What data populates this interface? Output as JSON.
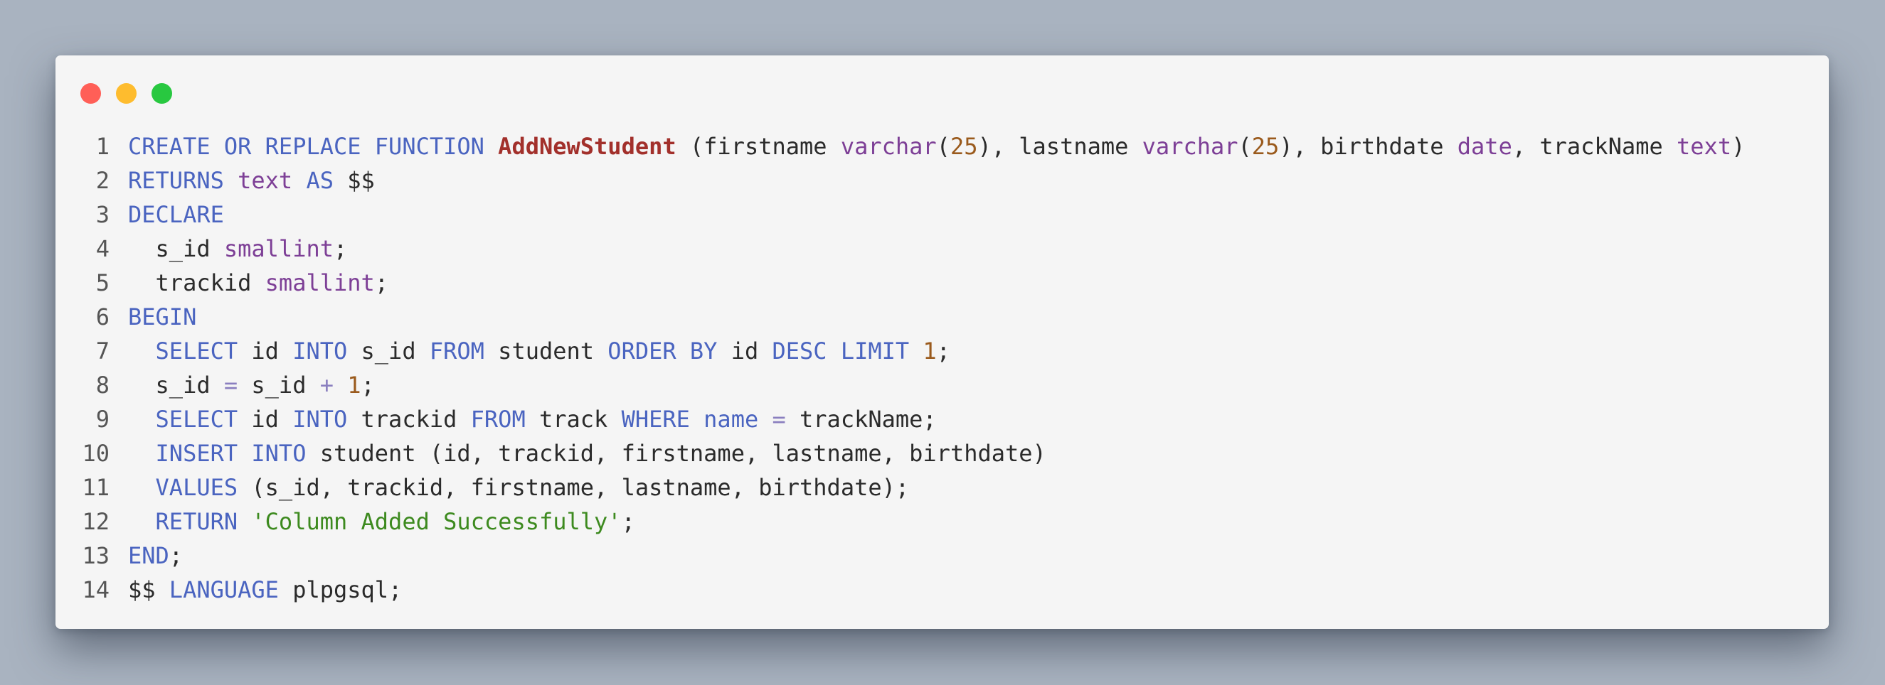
{
  "window": {
    "controls": [
      {
        "name": "close",
        "color": "#ff5f57"
      },
      {
        "name": "minimize",
        "color": "#febc2e"
      },
      {
        "name": "maximize",
        "color": "#28c840"
      }
    ]
  },
  "code": {
    "language": "plpgsql",
    "lines": [
      {
        "n": "1",
        "tokens": [
          {
            "t": "CREATE OR REPLACE FUNCTION",
            "c": "kw"
          },
          {
            "t": " ",
            "c": "plain"
          },
          {
            "t": "AddNewStudent",
            "c": "fn"
          },
          {
            "t": " (firstname ",
            "c": "plain"
          },
          {
            "t": "varchar",
            "c": "type"
          },
          {
            "t": "(",
            "c": "plain"
          },
          {
            "t": "25",
            "c": "num"
          },
          {
            "t": "), lastname ",
            "c": "plain"
          },
          {
            "t": "varchar",
            "c": "type"
          },
          {
            "t": "(",
            "c": "plain"
          },
          {
            "t": "25",
            "c": "num"
          },
          {
            "t": "), birthdate ",
            "c": "plain"
          },
          {
            "t": "date",
            "c": "type"
          },
          {
            "t": ", trackName ",
            "c": "plain"
          },
          {
            "t": "text",
            "c": "type"
          },
          {
            "t": ")",
            "c": "plain"
          }
        ]
      },
      {
        "n": "2",
        "tokens": [
          {
            "t": "RETURNS",
            "c": "kw"
          },
          {
            "t": " ",
            "c": "plain"
          },
          {
            "t": "text",
            "c": "type"
          },
          {
            "t": " ",
            "c": "plain"
          },
          {
            "t": "AS",
            "c": "kw"
          },
          {
            "t": " $$",
            "c": "plain"
          }
        ]
      },
      {
        "n": "3",
        "tokens": [
          {
            "t": "DECLARE",
            "c": "kw"
          }
        ]
      },
      {
        "n": "4",
        "tokens": [
          {
            "t": "  s_id ",
            "c": "plain"
          },
          {
            "t": "smallint",
            "c": "type"
          },
          {
            "t": ";",
            "c": "plain"
          }
        ]
      },
      {
        "n": "5",
        "tokens": [
          {
            "t": "  trackid ",
            "c": "plain"
          },
          {
            "t": "smallint",
            "c": "type"
          },
          {
            "t": ";",
            "c": "plain"
          }
        ]
      },
      {
        "n": "6",
        "tokens": [
          {
            "t": "BEGIN",
            "c": "kw"
          }
        ]
      },
      {
        "n": "7",
        "tokens": [
          {
            "t": "  ",
            "c": "plain"
          },
          {
            "t": "SELECT",
            "c": "kw"
          },
          {
            "t": " id ",
            "c": "plain"
          },
          {
            "t": "INTO",
            "c": "kw"
          },
          {
            "t": " s_id ",
            "c": "plain"
          },
          {
            "t": "FROM",
            "c": "kw"
          },
          {
            "t": " student ",
            "c": "plain"
          },
          {
            "t": "ORDER BY",
            "c": "kw"
          },
          {
            "t": " id ",
            "c": "plain"
          },
          {
            "t": "DESC LIMIT",
            "c": "kw"
          },
          {
            "t": " ",
            "c": "plain"
          },
          {
            "t": "1",
            "c": "num"
          },
          {
            "t": ";",
            "c": "plain"
          }
        ]
      },
      {
        "n": "8",
        "tokens": [
          {
            "t": "  s_id ",
            "c": "plain"
          },
          {
            "t": "=",
            "c": "op"
          },
          {
            "t": " s_id ",
            "c": "plain"
          },
          {
            "t": "+",
            "c": "op"
          },
          {
            "t": " ",
            "c": "plain"
          },
          {
            "t": "1",
            "c": "num"
          },
          {
            "t": ";",
            "c": "plain"
          }
        ]
      },
      {
        "n": "9",
        "tokens": [
          {
            "t": "  ",
            "c": "plain"
          },
          {
            "t": "SELECT",
            "c": "kw"
          },
          {
            "t": " id ",
            "c": "plain"
          },
          {
            "t": "INTO",
            "c": "kw"
          },
          {
            "t": " trackid ",
            "c": "plain"
          },
          {
            "t": "FROM",
            "c": "kw"
          },
          {
            "t": " track ",
            "c": "plain"
          },
          {
            "t": "WHERE",
            "c": "kw"
          },
          {
            "t": " ",
            "c": "plain"
          },
          {
            "t": "name",
            "c": "kw"
          },
          {
            "t": " ",
            "c": "plain"
          },
          {
            "t": "=",
            "c": "op"
          },
          {
            "t": " trackName;",
            "c": "plain"
          }
        ]
      },
      {
        "n": "10",
        "tokens": [
          {
            "t": "  ",
            "c": "plain"
          },
          {
            "t": "INSERT INTO",
            "c": "kw"
          },
          {
            "t": " student (id, trackid, firstname, lastname, birthdate)",
            "c": "plain"
          }
        ]
      },
      {
        "n": "11",
        "tokens": [
          {
            "t": "  ",
            "c": "plain"
          },
          {
            "t": "VALUES",
            "c": "kw"
          },
          {
            "t": " (s_id, trackid, firstname, lastname, birthdate);",
            "c": "plain"
          }
        ]
      },
      {
        "n": "12",
        "tokens": [
          {
            "t": "  ",
            "c": "plain"
          },
          {
            "t": "RETURN",
            "c": "kw"
          },
          {
            "t": " ",
            "c": "plain"
          },
          {
            "t": "'Column Added Successfully'",
            "c": "str"
          },
          {
            "t": ";",
            "c": "plain"
          }
        ]
      },
      {
        "n": "13",
        "tokens": [
          {
            "t": "END",
            "c": "kw"
          },
          {
            "t": ";",
            "c": "plain"
          }
        ]
      },
      {
        "n": "14",
        "tokens": [
          {
            "t": "$$ ",
            "c": "plain"
          },
          {
            "t": "LANGUAGE",
            "c": "kw"
          },
          {
            "t": " plpgsql;",
            "c": "plain"
          }
        ]
      }
    ]
  }
}
